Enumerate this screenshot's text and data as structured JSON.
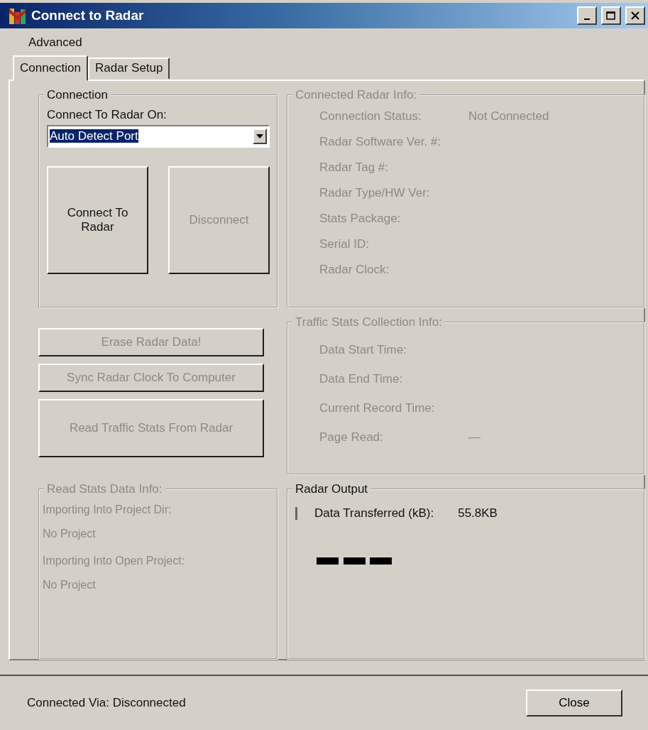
{
  "window": {
    "title": "Connect to Radar"
  },
  "menu": [
    {
      "label": "Advanced"
    }
  ],
  "tabs": [
    {
      "label": "Connection",
      "selected": true
    },
    {
      "label": "Radar Setup",
      "selected": false
    }
  ],
  "connection_group": {
    "title": "Connection",
    "port_label": "Connect To Radar On:",
    "port_select": {
      "value": "Auto Detect Port",
      "highlighted": true
    },
    "buttons": [
      {
        "label": "Connect To Radar",
        "disabled": false
      },
      {
        "label": "Disconnect",
        "disabled": true
      }
    ]
  },
  "radar_info": {
    "title": "Connected Radar Info:",
    "disabled": true,
    "rows": [
      {
        "label": "Connection Status:",
        "value": "Not Connected"
      },
      {
        "label": "Radar Software Ver. #:"
      },
      {
        "label": "Radar Tag #:"
      },
      {
        "label": "Radar Type/HW Ver:"
      },
      {
        "label": "Stats Package:"
      },
      {
        "label": "Serial ID:"
      },
      {
        "label": "Radar Clock:"
      }
    ]
  },
  "actions": [
    {
      "label": "Erase Radar Data!",
      "disabled": true
    },
    {
      "label": "Sync Radar Clock To Computer",
      "disabled": true
    },
    {
      "label": "Read Traffic Stats From Radar",
      "disabled": true
    }
  ],
  "traffic_info": {
    "title": "Traffic Stats Collection Info:",
    "disabled": true,
    "rows": [
      {
        "label": "Data Start Time:"
      },
      {
        "label": "Data End Time:"
      },
      {
        "label": "Current Record Time:"
      },
      {
        "label": "Page Read:",
        "value": "—"
      }
    ]
  },
  "read_stats_info": {
    "title": "Read Stats Data Info:",
    "disabled": true,
    "lines": [
      "Importing Into Project Dir:",
      "No Project",
      "Importing Into Open Project:",
      "No Project"
    ]
  },
  "radar_output": {
    "title": "Radar Output",
    "disabled": false,
    "label": "Data Transferred (kB):",
    "value": "55.8KB"
  },
  "status_bar": {
    "text": "Connected Via: Disconnected",
    "close_button": "Close"
  }
}
